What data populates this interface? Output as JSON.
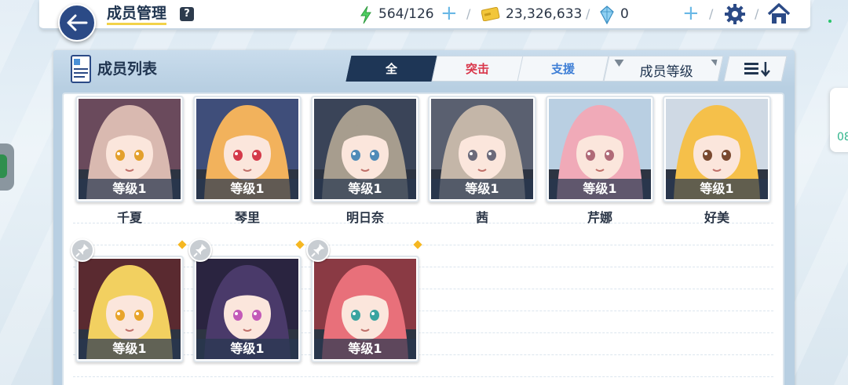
{
  "header": {
    "title": "成员管理",
    "help_label": "?",
    "ap": "564/126",
    "credits": "23,326,633",
    "pyroxene": "0",
    "plus": "+",
    "sep": "/"
  },
  "panel": {
    "title": "成员列表",
    "tabs": [
      {
        "label": "全",
        "color": "#ffffff"
      },
      {
        "label": "突击",
        "color": "#d9364a"
      },
      {
        "label": "支援",
        "color": "#3f7fd6"
      }
    ],
    "sort_label": "成员等级"
  },
  "side": {
    "right_tab_text": "08"
  },
  "students": [
    {
      "name": "千夏",
      "level": "等级1",
      "hair": "#d9b9b0",
      "bg": "#6a4a5c",
      "eye": "#e3a02c"
    },
    {
      "name": "琴里",
      "level": "等级1",
      "hair": "#f2b25c",
      "bg": "#3f4e7a",
      "eye": "#d43a4a"
    },
    {
      "name": "明日奈",
      "level": "等级1",
      "hair": "#a79d8e",
      "bg": "#3a4458",
      "eye": "#4f8bb8"
    },
    {
      "name": "茜",
      "level": "等级1",
      "hair": "#c4b6a8",
      "bg": "#5a6070",
      "eye": "#6b6a7a"
    },
    {
      "name": "芹娜",
      "level": "等级1",
      "hair": "#f0aab8",
      "bg": "#b9cfe2",
      "eye": "#b06a78"
    },
    {
      "name": "好美",
      "level": "等级1",
      "hair": "#f5c04a",
      "bg": "#cfd9e4",
      "eye": "#7a4a30"
    },
    {
      "name": "",
      "level": "等级1",
      "hair": "#f2d060",
      "bg": "#5a2a30",
      "eye": "#e8a42a"
    },
    {
      "name": "",
      "level": "等级1",
      "hair": "#4a3a6a",
      "bg": "#2a2440",
      "eye": "#c35ab8"
    },
    {
      "name": "",
      "level": "等级1",
      "hair": "#e8707a",
      "bg": "#8a3a44",
      "eye": "#3aa4a0"
    }
  ]
}
